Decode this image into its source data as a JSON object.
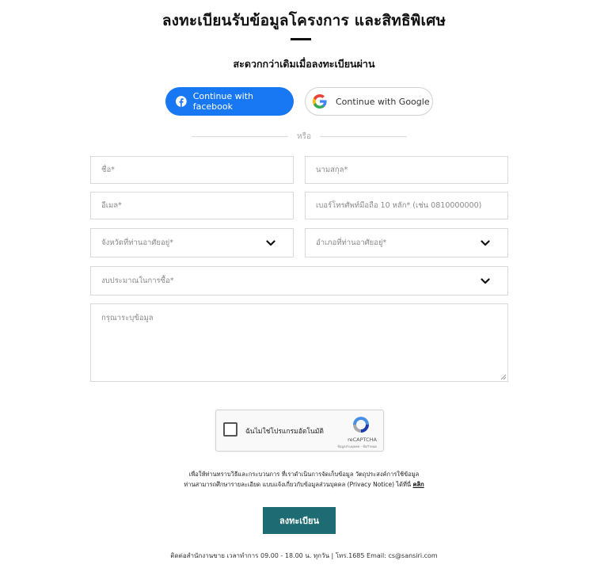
{
  "header": {
    "title": "ลงทะเบียนรับข้อมูลโครงการ และสิทธิพิเศษ",
    "subtitle": "สะดวกกว่าเดิมเมื่อลงทะเบียนผ่าน"
  },
  "social": {
    "facebook_label": "Continue with facebook",
    "google_label": "Continue with Google",
    "divider_text": "หรือ"
  },
  "form": {
    "first_name_placeholder": "ชื่อ*",
    "last_name_placeholder": "นามสกุล*",
    "email_placeholder": "อีเมล*",
    "phone_placeholder": "เบอร์โทรศัพท์มือถือ 10 หลัก* (เช่น 0810000000)",
    "province_placeholder": "จังหวัดที่ท่านอาศัยอยู่*",
    "district_placeholder": "อำเภอที่ท่านอาศัยอยู่*",
    "budget_placeholder": "งบประมาณในการซื้อ*",
    "message_placeholder": "กรุณาระบุข้อมูล"
  },
  "captcha": {
    "label": "ฉันไม่ใช่โปรแกรมอัตโนมัติ",
    "brand": "reCAPTCHA",
    "terms": "ข้อมูลส่วนบุคคล - ข้อกำหนด"
  },
  "notice": {
    "line1": "เพื่อให้ท่านทราบวิธีและกระบวนการ ที่เราดำเนินการจัดเก็บข้อมูล วัตถุประสงค์การใช้ข้อมูล",
    "line2": "ท่านสามารถศึกษารายละเอียด แบบแจ้งเกี่ยวกับข้อมูลส่วนบุคคล (Privacy Notice) ได้ที่นี่",
    "link": "คลิก"
  },
  "submit_label": "ลงทะเบียน",
  "footer_text": "ติดต่อสำนักงานขาย เวลาทำการ 09.00 - 18.00 น. ทุกวัน | โทร.1685 Email: cs@sansiri.com",
  "colors": {
    "facebook_blue": "#1877f2",
    "submit_teal": "#1f6b73"
  },
  "icons": [
    "facebook-icon",
    "google-icon",
    "chevron-down-icon",
    "recaptcha-icon"
  ]
}
